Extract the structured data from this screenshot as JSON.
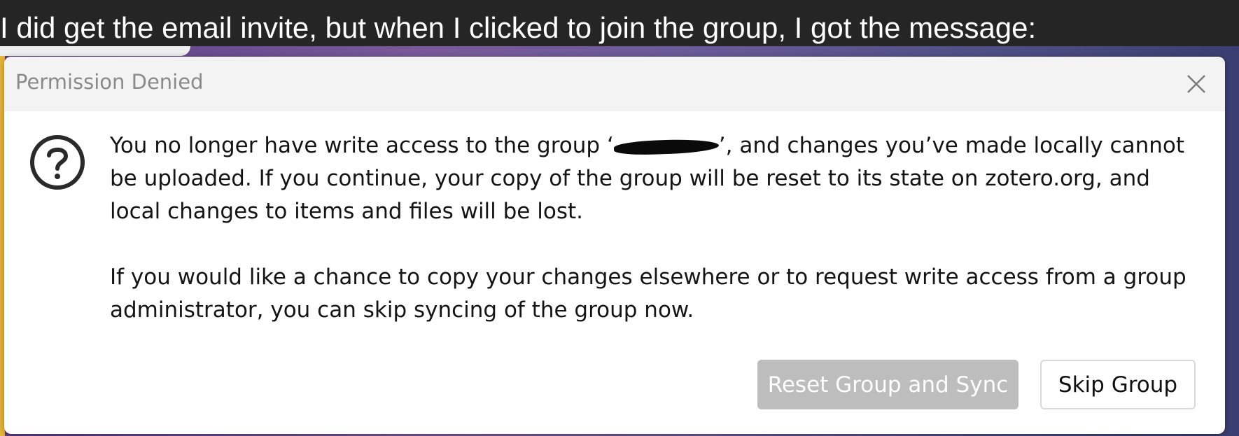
{
  "caption": {
    "text": "I did get the email invite, but when I clicked to join the group, I got the message:"
  },
  "dialog": {
    "title": "Permission Denied",
    "close_icon": "close-icon",
    "question_icon": "question-circle-icon",
    "message": {
      "p1_before": "You no longer have write access to the group ‘",
      "group_name_redacted": "",
      "p1_after": "’, and changes you’ve made locally cannot be uploaded. If you continue, your copy of the group will be reset to its state on zotero.org, and local changes to items and files will be lost.",
      "p2": "If you would like a chance to copy your changes elsewhere or to request write access from a group administrator, you can skip syncing of the group now."
    },
    "buttons": {
      "reset_label": "Reset Group and Sync",
      "skip_label": "Skip Group"
    }
  },
  "colors": {
    "titlebar": "#f3f3f3",
    "title_text": "#8a8a8a",
    "reset_button_bg": "#bdbdbd",
    "caption_bg": "#252525"
  }
}
